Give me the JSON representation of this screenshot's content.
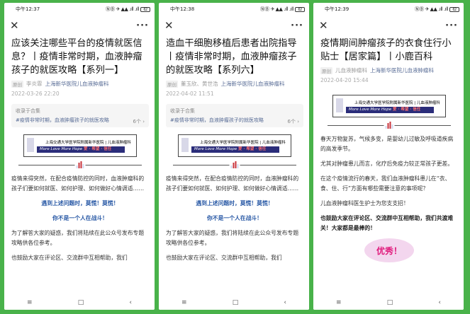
{
  "phones": [
    {
      "status": {
        "time": "中午12:37",
        "signal": "ⓃⒷ ✈ ▲▲ .ıll .ıll",
        "battery": "62"
      },
      "title": "应该关注哪些平台的疫情就医信息？丨疫情非常时期，血液肿瘤孩子的就医攻略【系列一】",
      "tag": "原创",
      "author": "李炎霏",
      "account": "上海新华医院儿血液肿瘤科",
      "date": "2022-03-26 22:20",
      "collection": {
        "label": "收录于合集",
        "name": "#疫情非常时期，血液肿瘤孩子的就医攻略",
        "count": "6个 ›"
      },
      "paragraphs": [
        "疫情来得突然，在配合疫情防控的同时，血液肿瘤科的孩子们要如何就医、如何护理、如何做好心情调适……",
        "遇到上述问题时，莫慌！莫慌！",
        "你不是一个人在战斗！",
        "为了解答大家的疑惑，我们将陆续在此公众号发布专题攻略供各位参考。",
        "也鼓励大家在评论区、交流群中互相帮助，我们"
      ]
    },
    {
      "status": {
        "time": "中午12:38",
        "signal": "ⓃⒷ ✈ ▲▲ .ıll .ıll",
        "battery": "62"
      },
      "title": "造血干细胞移植后患者出院指导丨疫情非常时期，血液肿瘤孩子的就医攻略【系列六】",
      "tag": "原创",
      "author": "董玉欣、黄世浩",
      "account": "上海新华医院儿血液肿瘤科",
      "date": "2022-04-02 11:51",
      "collection": {
        "label": "收录于合集",
        "name": "#疫情非常时期，血液肿瘤孩子的就医攻略",
        "count": "6个 ›"
      },
      "paragraphs": [
        "疫情来得突然，在配合疫情防控的同时，血液肿瘤科的孩子们要如何就医、如何护理、如何做好心情调适……",
        "遇到上述问题时，莫慌！莫慌！",
        "你不是一个人在战斗！",
        "为了解答大家的疑惑，我们将陆续在此公众号发布专题攻略供各位参考。",
        "也鼓励大家在评论区、交流群中互相帮助，我们"
      ]
    },
    {
      "status": {
        "time": "中午12:39",
        "signal": "ⓃⒷ ✈ ▲▲ .ıll .ıll",
        "battery": "62"
      },
      "title": "疫情期间肿瘤孩子的衣食住行小贴士【居家篇】丨小鹿百科",
      "tag": "原创",
      "author": "儿血液肿瘤科",
      "account": "上海新华医院儿血液肿瘤科",
      "date": "2022-04-20 15:44",
      "paragraphs": [
        "春天万物复苏，气候多变，是婴幼儿过敏及呼吸道疾病的高发季节。",
        "尤其对肿瘤患儿而言，化疗后免疫力较正常孩子更差。",
        "在这个疫情流行的春天，我们血液肿瘤科患儿在“衣、食、住、行”方面有哪些需要注意的事项呢？",
        "儿血液肿瘤科医生护士为您支支招！",
        "也鼓励大家在评论区、交流群中互相帮助，我们共渡难关！大家都是最棒的！"
      ],
      "sticker": "优秀！"
    }
  ],
  "banner": {
    "line1": "上海交通大学医学院附属新华医院 | 儿血液肿瘤科",
    "line2": "More Love More Hope",
    "line2_tail": "爱 · 希望 · 信任"
  },
  "bottom_nav": {
    "menu": "≡",
    "home": "□",
    "back": "‹"
  }
}
